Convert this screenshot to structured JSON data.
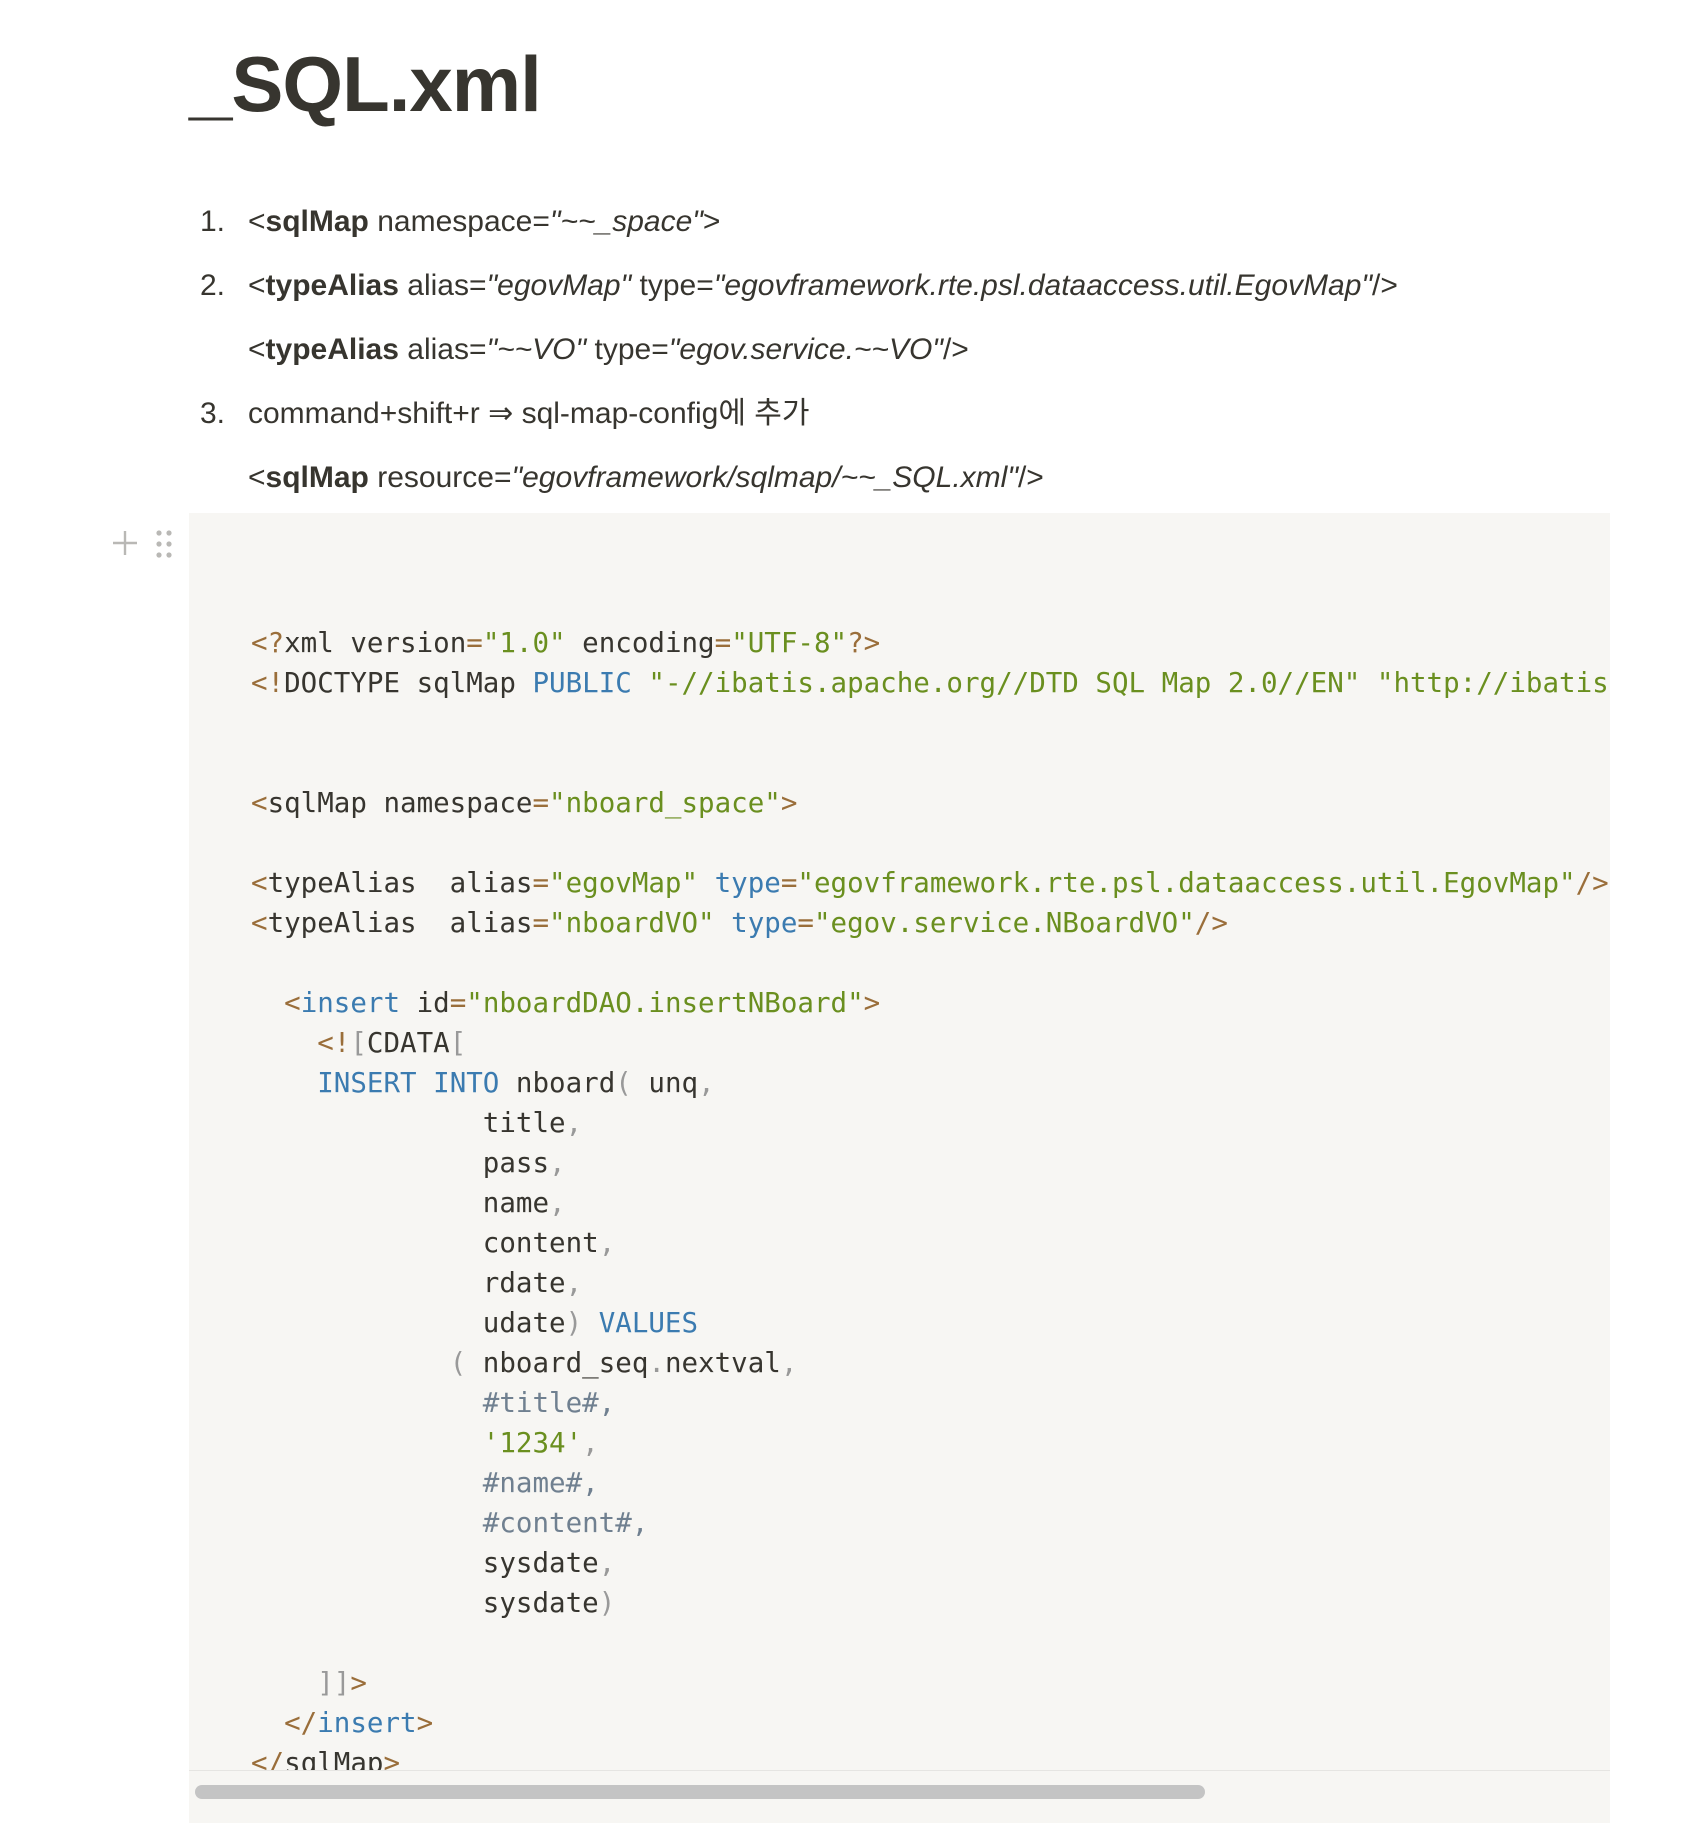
{
  "page": {
    "title": "_SQL.xml"
  },
  "list": [
    {
      "number": "1.",
      "lines": [
        [
          {
            "t": "<"
          },
          {
            "t": "sqlMap",
            "b": true
          },
          {
            "t": " namespace="
          },
          {
            "t": "\"~~_space\"",
            "i": true
          },
          {
            "t": ">"
          }
        ]
      ]
    },
    {
      "number": "2.",
      "lines": [
        [
          {
            "t": "<"
          },
          {
            "t": "typeAlias",
            "b": true
          },
          {
            "t": "  alias="
          },
          {
            "t": "\"egovMap\"",
            "i": true
          },
          {
            "t": " type="
          },
          {
            "t": "\"egovframework.rte.psl.dataaccess.util.EgovMap\"",
            "i": true
          },
          {
            "t": "/>"
          }
        ],
        [
          {
            "t": "<"
          },
          {
            "t": "typeAlias",
            "b": true
          },
          {
            "t": "  alias="
          },
          {
            "t": "\"~~VO\"",
            "i": true
          },
          {
            "t": " type="
          },
          {
            "t": "\"egov.service.~~VO\"",
            "i": true
          },
          {
            "t": "/>"
          }
        ]
      ]
    },
    {
      "number": "3.",
      "lines": [
        [
          {
            "t": "command+shift+r ⇒ sql-map-config에 추가"
          }
        ],
        [
          {
            "t": "<"
          },
          {
            "t": "sqlMap",
            "b": true
          },
          {
            "t": " resource="
          },
          {
            "t": "\"egovframework/sqlmap/~~_SQL.xml\"",
            "i": true
          },
          {
            "t": "/>"
          }
        ]
      ]
    }
  ],
  "code": {
    "lines": [
      [],
      [
        [
          "br",
          "<?"
        ],
        [
          "tag",
          "xml version"
        ],
        [
          "br",
          "="
        ],
        [
          "str",
          "\"1.0\""
        ],
        [
          "tag",
          " encoding"
        ],
        [
          "br",
          "="
        ],
        [
          "str",
          "\"UTF-8\""
        ],
        [
          "br",
          "?>"
        ]
      ],
      [
        [
          "br",
          "<!"
        ],
        [
          "tag",
          "DOCTYPE sqlMap "
        ],
        [
          "kw",
          "PUBLIC"
        ],
        [
          "tag",
          " "
        ],
        [
          "str",
          "\"-//ibatis.apache.org//DTD SQL Map 2.0//EN\""
        ],
        [
          "tag",
          " "
        ],
        [
          "str",
          "\"http://ibatis."
        ]
      ],
      [],
      [],
      [
        [
          "br",
          "<"
        ],
        [
          "tag",
          "sqlMap namespace"
        ],
        [
          "br",
          "="
        ],
        [
          "str",
          "\"nboard_space\""
        ],
        [
          "br",
          ">"
        ]
      ],
      [],
      [
        [
          "br",
          "<"
        ],
        [
          "tag",
          "typeAlias  alias"
        ],
        [
          "br",
          "="
        ],
        [
          "str",
          "\"egovMap\""
        ],
        [
          "tag",
          " "
        ],
        [
          "kw",
          "type"
        ],
        [
          "br",
          "="
        ],
        [
          "str",
          "\"egovframework.rte.psl.dataaccess.util.EgovMap\""
        ],
        [
          "br",
          "/>"
        ]
      ],
      [
        [
          "br",
          "<"
        ],
        [
          "tag",
          "typeAlias  alias"
        ],
        [
          "br",
          "="
        ],
        [
          "str",
          "\"nboardVO\""
        ],
        [
          "tag",
          " "
        ],
        [
          "kw",
          "type"
        ],
        [
          "br",
          "="
        ],
        [
          "str",
          "\"egov.service.NBoardVO\""
        ],
        [
          "br",
          "/>"
        ]
      ],
      [],
      [
        [
          "tag",
          "  "
        ],
        [
          "br",
          "<"
        ],
        [
          "kw",
          "insert"
        ],
        [
          "tag",
          " id"
        ],
        [
          "br",
          "="
        ],
        [
          "str",
          "\"nboardDAO.insertNBoard\""
        ],
        [
          "br",
          ">"
        ]
      ],
      [
        [
          "tag",
          "    "
        ],
        [
          "br",
          "<!"
        ],
        [
          "pun",
          "["
        ],
        [
          "tag",
          "CDATA"
        ],
        [
          "pun",
          "["
        ]
      ],
      [
        [
          "tag",
          "    "
        ],
        [
          "kw",
          "INSERT"
        ],
        [
          "tag",
          " "
        ],
        [
          "kw",
          "INTO"
        ],
        [
          "tag",
          " nboard"
        ],
        [
          "pun",
          "("
        ],
        [
          "tag",
          " unq"
        ],
        [
          "pun",
          ","
        ]
      ],
      [
        [
          "tag",
          "              title"
        ],
        [
          "pun",
          ","
        ]
      ],
      [
        [
          "tag",
          "              pass"
        ],
        [
          "pun",
          ","
        ]
      ],
      [
        [
          "tag",
          "              name"
        ],
        [
          "pun",
          ","
        ]
      ],
      [
        [
          "tag",
          "              content"
        ],
        [
          "pun",
          ","
        ]
      ],
      [
        [
          "tag",
          "              rdate"
        ],
        [
          "pun",
          ","
        ]
      ],
      [
        [
          "tag",
          "              udate"
        ],
        [
          "pun",
          ")"
        ],
        [
          "tag",
          " "
        ],
        [
          "kw",
          "VALUES"
        ]
      ],
      [
        [
          "tag",
          "            "
        ],
        [
          "pun",
          "("
        ],
        [
          "tag",
          " nboard_seq"
        ],
        [
          "pun",
          "."
        ],
        [
          "tag",
          "nextval"
        ],
        [
          "pun",
          ","
        ]
      ],
      [
        [
          "cmt",
          "              #title#,"
        ]
      ],
      [
        [
          "tag",
          "              "
        ],
        [
          "str",
          "'1234'"
        ],
        [
          "pun",
          ","
        ]
      ],
      [
        [
          "cmt",
          "              #name#,"
        ]
      ],
      [
        [
          "cmt",
          "              #content#,"
        ]
      ],
      [
        [
          "tag",
          "              sysdate"
        ],
        [
          "pun",
          ","
        ]
      ],
      [
        [
          "tag",
          "              sysdate"
        ],
        [
          "pun",
          ")"
        ]
      ],
      [],
      [
        [
          "tag",
          "    "
        ],
        [
          "pun",
          "]]"
        ],
        [
          "br",
          ">"
        ]
      ],
      [
        [
          "tag",
          "  "
        ],
        [
          "br",
          "</"
        ],
        [
          "kw",
          "insert"
        ],
        [
          "br",
          ">"
        ]
      ],
      [
        [
          "br",
          "</"
        ],
        [
          "tag",
          "sqlMap"
        ],
        [
          "br",
          ">"
        ]
      ]
    ]
  },
  "icons": {
    "add_block": "plus-icon",
    "drag_handle": "drag-handle-icon"
  },
  "colors": {
    "text": "#37352f",
    "code_background": "#f7f6f3",
    "string": "#6a8f1f",
    "keyword": "#3b7bb0",
    "bracket": "#9a6e3a",
    "punctuation": "#999999",
    "variable": "#708090",
    "scrollbar_thumb": "#c4c4c4"
  }
}
